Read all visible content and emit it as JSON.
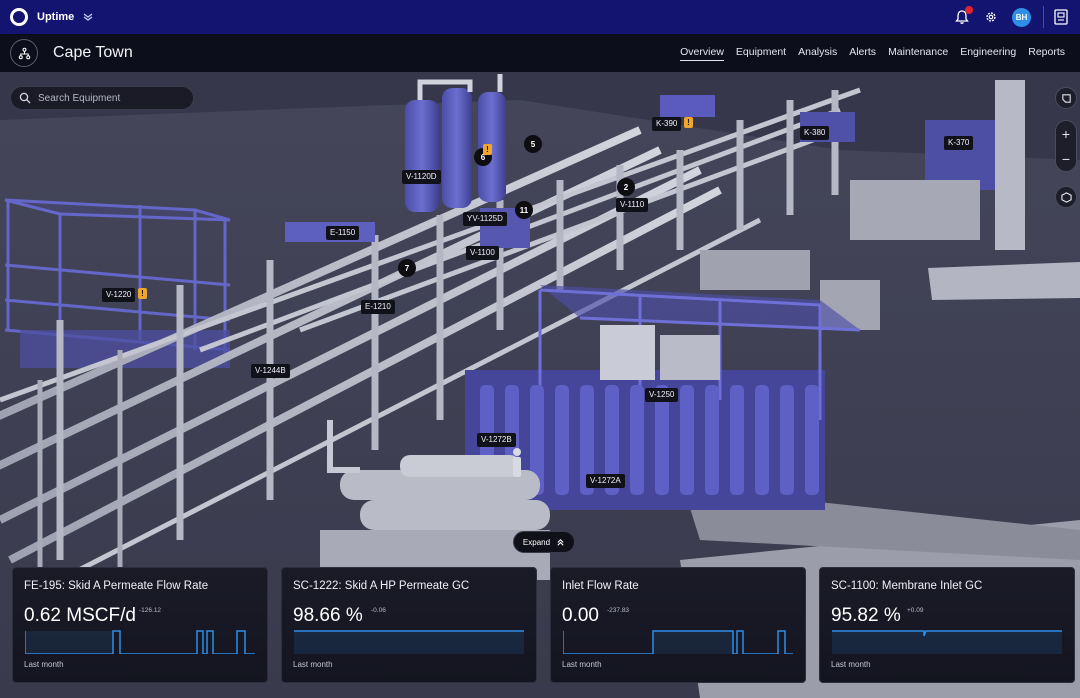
{
  "app": {
    "name": "Uptime",
    "user_initials": "BH"
  },
  "header": {
    "title": "Cape Town",
    "tabs": [
      {
        "label": "Overview",
        "active": true
      },
      {
        "label": "Equipment"
      },
      {
        "label": "Analysis"
      },
      {
        "label": "Alerts"
      },
      {
        "label": "Maintenance"
      },
      {
        "label": "Engineering"
      },
      {
        "label": "Reports"
      }
    ]
  },
  "search": {
    "placeholder": "Search Equipment"
  },
  "equipment_tags": {
    "k390": "K-390",
    "k380": "K-380",
    "k370": "K-370",
    "v1120d": "V-1120D",
    "yv1125d": "YV-1125D",
    "v1100": "V-1100",
    "v1110": "V-1110",
    "e1150": "E-1150",
    "e1210": "E-1210",
    "v1220": "V-1220",
    "v1244b": "V-1244B",
    "v1250": "V-1250",
    "v1272b": "V-1272B",
    "v1272a": "V-1272A"
  },
  "markers": {
    "m6": "6",
    "m5": "5",
    "m2": "2",
    "m11": "11",
    "m7": "7"
  },
  "warning_glyph": "!",
  "expand_label": "Expand",
  "zoom": {
    "in": "+",
    "out": "−"
  },
  "cards": [
    {
      "title": "FE-195: Skid A Permeate Flow Rate",
      "value": "0.62 MSCF/d",
      "delta": "-126.12",
      "period": "Last month"
    },
    {
      "title": "SC-1222: Skid A HP Permeate GC",
      "value": "98.66 %",
      "delta": "-0.06",
      "period": "Last month"
    },
    {
      "title": "Inlet Flow Rate",
      "value": "0.00",
      "delta": "-237.83",
      "period": "Last month"
    },
    {
      "title": "SC-1100: Membrane Inlet GC",
      "value": "95.82 %",
      "delta": "+0.09",
      "period": "Last month"
    }
  ],
  "colors": {
    "topbar": "#121470",
    "header": "#0d0e1b",
    "accent": "#2e8ee8",
    "warning": "#f0a62c",
    "equipment_purple": "#5a5bbd",
    "pipe_gray": "#b8bac7"
  }
}
